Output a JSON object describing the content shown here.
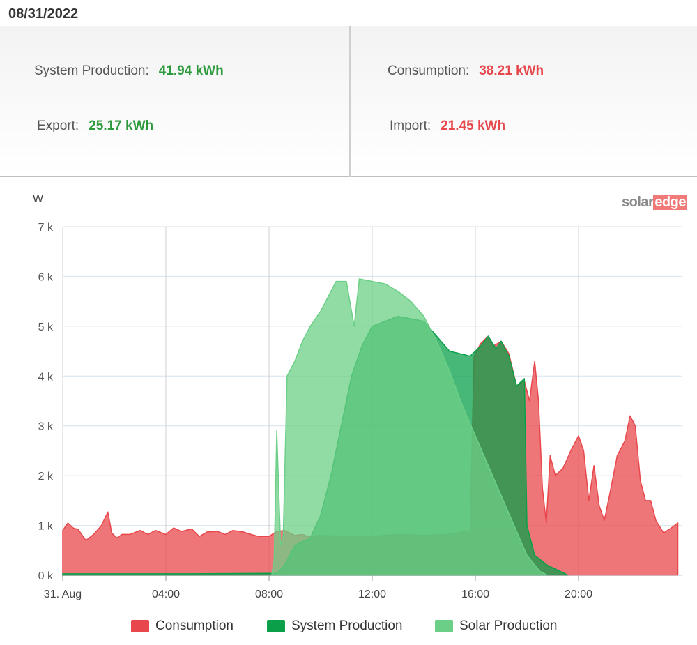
{
  "header": {
    "date": "08/31/2022"
  },
  "summary": {
    "production_label": "System Production:",
    "production_value": "41.94 kWh",
    "consumption_label": "Consumption:",
    "consumption_value": "38.21 kWh",
    "export_label": "Export:",
    "export_value": "25.17 kWh",
    "import_label": "Import:",
    "import_value": "21.45 kWh"
  },
  "logo": {
    "solar": "solar",
    "edge": "edge"
  },
  "colors": {
    "consumption": "#e8474b",
    "system_production": "#0aa04a",
    "solar_production": "#6ccf87",
    "positive": "#2e9a3e",
    "negative": "#e5484d"
  },
  "chart_data": {
    "type": "area",
    "ylabel": "W",
    "ylim": [
      0,
      7000
    ],
    "xlim_hours": [
      0,
      24
    ],
    "xticks": [
      {
        "hour": 0,
        "label": "31. Aug"
      },
      {
        "hour": 4,
        "label": "04:00"
      },
      {
        "hour": 8,
        "label": "08:00"
      },
      {
        "hour": 12,
        "label": "12:00"
      },
      {
        "hour": 16,
        "label": "16:00"
      },
      {
        "hour": 20,
        "label": "20:00"
      }
    ],
    "yticks": [
      {
        "value": 0,
        "label": "0 k"
      },
      {
        "value": 1000,
        "label": "1 k"
      },
      {
        "value": 2000,
        "label": "2 k"
      },
      {
        "value": 3000,
        "label": "3 k"
      },
      {
        "value": 4000,
        "label": "4 k"
      },
      {
        "value": 5000,
        "label": "5 k"
      },
      {
        "value": 6000,
        "label": "6 k"
      },
      {
        "value": 7000,
        "label": "7 k"
      }
    ],
    "grid": true,
    "legend_position": "bottom",
    "series": [
      {
        "name": "Consumption",
        "color_key": "consumption",
        "points": [
          [
            0,
            900
          ],
          [
            0.2,
            1050
          ],
          [
            0.4,
            950
          ],
          [
            0.6,
            920
          ],
          [
            0.9,
            700
          ],
          [
            1.2,
            820
          ],
          [
            1.5,
            1000
          ],
          [
            1.75,
            1270
          ],
          [
            1.9,
            850
          ],
          [
            2.1,
            750
          ],
          [
            2.3,
            820
          ],
          [
            2.6,
            820
          ],
          [
            3.0,
            900
          ],
          [
            3.3,
            820
          ],
          [
            3.6,
            900
          ],
          [
            4.0,
            820
          ],
          [
            4.3,
            950
          ],
          [
            4.6,
            880
          ],
          [
            5.0,
            930
          ],
          [
            5.3,
            780
          ],
          [
            5.6,
            870
          ],
          [
            6.0,
            880
          ],
          [
            6.3,
            820
          ],
          [
            6.6,
            900
          ],
          [
            7.0,
            870
          ],
          [
            7.3,
            820
          ],
          [
            7.6,
            780
          ],
          [
            8.0,
            780
          ],
          [
            8.3,
            880
          ],
          [
            8.6,
            900
          ],
          [
            9.0,
            800
          ],
          [
            9.3,
            820
          ],
          [
            9.5,
            780
          ],
          [
            10.0,
            800
          ],
          [
            11.0,
            780
          ],
          [
            12.0,
            780
          ],
          [
            13.0,
            820
          ],
          [
            14.0,
            800
          ],
          [
            15.0,
            820
          ],
          [
            15.8,
            900
          ],
          [
            15.95,
            4400
          ],
          [
            16.2,
            4650
          ],
          [
            16.5,
            4800
          ],
          [
            16.7,
            4600
          ],
          [
            17.0,
            4700
          ],
          [
            17.3,
            4450
          ],
          [
            17.6,
            3800
          ],
          [
            17.9,
            3900
          ],
          [
            18.1,
            3500
          ],
          [
            18.3,
            4300
          ],
          [
            18.45,
            3500
          ],
          [
            18.6,
            1750
          ],
          [
            18.75,
            1050
          ],
          [
            18.9,
            2400
          ],
          [
            19.1,
            2000
          ],
          [
            19.4,
            2150
          ],
          [
            19.7,
            2500
          ],
          [
            20.0,
            2800
          ],
          [
            20.2,
            2500
          ],
          [
            20.4,
            1500
          ],
          [
            20.6,
            2200
          ],
          [
            20.8,
            1400
          ],
          [
            21.0,
            1100
          ],
          [
            21.2,
            1600
          ],
          [
            21.5,
            2400
          ],
          [
            21.8,
            2700
          ],
          [
            22.0,
            3200
          ],
          [
            22.2,
            3000
          ],
          [
            22.4,
            1900
          ],
          [
            22.6,
            1500
          ],
          [
            22.8,
            1500
          ],
          [
            23.0,
            1100
          ],
          [
            23.3,
            850
          ],
          [
            23.6,
            950
          ],
          [
            23.85,
            1050
          ]
        ]
      },
      {
        "name": "System Production",
        "color_key": "system_production",
        "points": [
          [
            0,
            30
          ],
          [
            5,
            30
          ],
          [
            8.3,
            40
          ],
          [
            8.6,
            200
          ],
          [
            9.0,
            600
          ],
          [
            9.6,
            750
          ],
          [
            10.0,
            1200
          ],
          [
            10.4,
            2000
          ],
          [
            10.8,
            3000
          ],
          [
            11.2,
            4000
          ],
          [
            11.6,
            4600
          ],
          [
            12.0,
            5000
          ],
          [
            13.0,
            5200
          ],
          [
            14.0,
            5100
          ],
          [
            15.0,
            4500
          ],
          [
            15.8,
            4400
          ],
          [
            16.2,
            4600
          ],
          [
            16.5,
            4800
          ],
          [
            16.8,
            4550
          ],
          [
            17.0,
            4700
          ],
          [
            17.3,
            4400
          ],
          [
            17.6,
            3800
          ],
          [
            17.9,
            3950
          ],
          [
            18.0,
            1000
          ],
          [
            18.3,
            400
          ],
          [
            18.8,
            200
          ],
          [
            19.4,
            50
          ],
          [
            19.6,
            0
          ]
        ]
      },
      {
        "name": "Solar Production",
        "color_key": "solar_production",
        "points": [
          [
            8.1,
            0
          ],
          [
            8.2,
            300
          ],
          [
            8.3,
            2900
          ],
          [
            8.45,
            600
          ],
          [
            8.55,
            800
          ],
          [
            8.7,
            4000
          ],
          [
            9.0,
            4300
          ],
          [
            9.3,
            4700
          ],
          [
            9.6,
            5000
          ],
          [
            10.0,
            5300
          ],
          [
            10.3,
            5600
          ],
          [
            10.6,
            5900
          ],
          [
            11.0,
            5900
          ],
          [
            11.3,
            5000
          ],
          [
            11.5,
            5950
          ],
          [
            12.0,
            5900
          ],
          [
            12.5,
            5850
          ],
          [
            13.0,
            5700
          ],
          [
            13.5,
            5500
          ],
          [
            14.0,
            5200
          ],
          [
            14.5,
            4700
          ],
          [
            15.0,
            4100
          ],
          [
            15.5,
            3400
          ],
          [
            16.0,
            2800
          ],
          [
            16.5,
            2200
          ],
          [
            17.0,
            1600
          ],
          [
            17.5,
            1000
          ],
          [
            18.0,
            400
          ],
          [
            18.5,
            80
          ],
          [
            18.8,
            0
          ]
        ]
      }
    ]
  },
  "legend": [
    {
      "label": "Consumption",
      "color_key": "consumption"
    },
    {
      "label": "System Production",
      "color_key": "system_production"
    },
    {
      "label": "Solar Production",
      "color_key": "solar_production"
    }
  ]
}
